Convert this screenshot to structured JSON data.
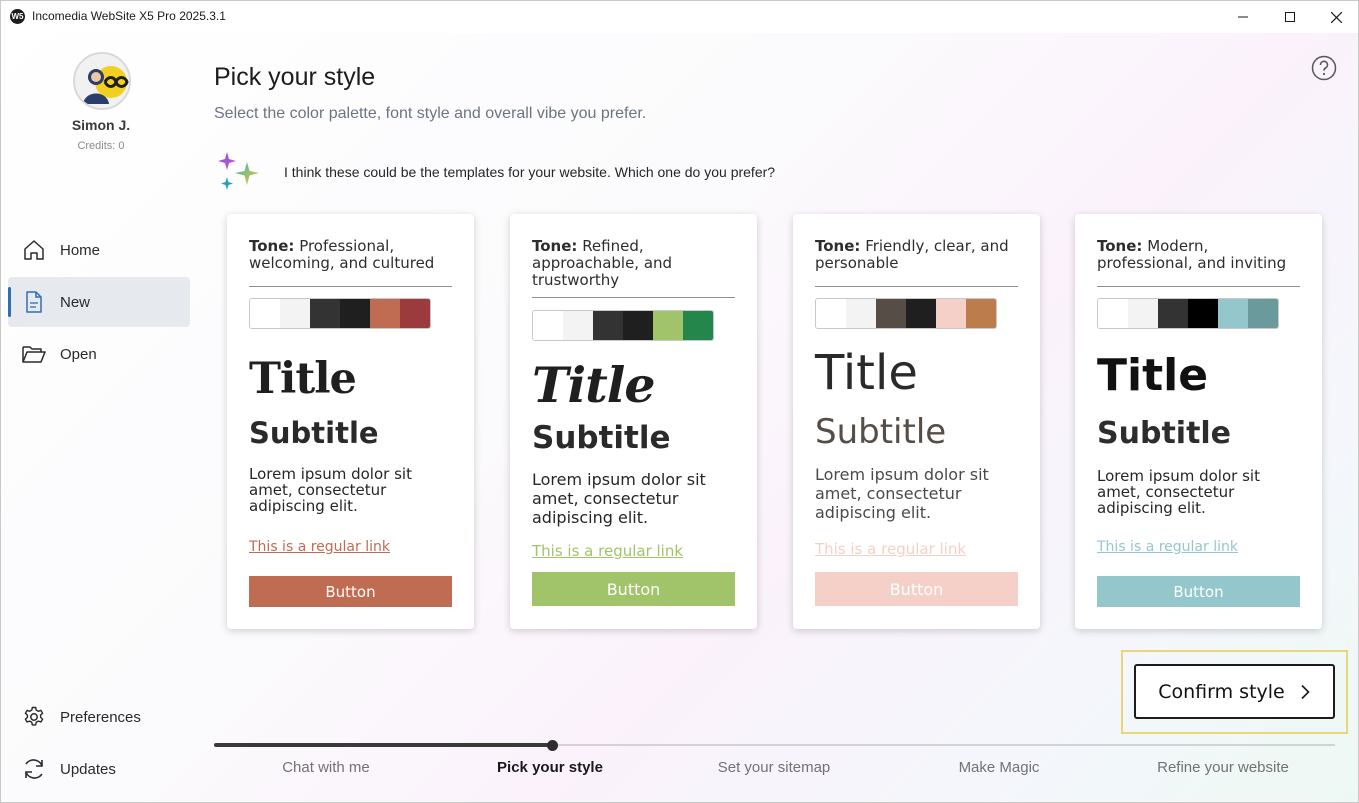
{
  "window": {
    "title": "Incomedia WebSite X5 Pro 2025.3.1",
    "app_icon_text": "W5"
  },
  "user": {
    "name": "Simon J.",
    "credits": "Credits: 0"
  },
  "sidebar": {
    "items": [
      {
        "label": "Home",
        "icon": "home-icon"
      },
      {
        "label": "New",
        "icon": "new-file-icon",
        "active": true
      },
      {
        "label": "Open",
        "icon": "folder-open-icon"
      }
    ],
    "bottom_items": [
      {
        "label": "Preferences",
        "icon": "gear-icon"
      },
      {
        "label": "Updates",
        "icon": "refresh-icon"
      }
    ]
  },
  "main": {
    "title": "Pick your style",
    "subtitle": "Select the color palette, font style and overall vibe you prefer.",
    "ai_message": "I think these could be the templates for your website. Which one do you prefer?"
  },
  "templates": [
    {
      "tone_label": "Tone:",
      "tone": "Professional, welcoming, and cultured",
      "palette": [
        "#ffffff",
        "#f3f3f3",
        "#333333",
        "#1f1f1f",
        "#c06c52",
        "#9c3b3d"
      ],
      "sample_title": "Title",
      "sample_subtitle": "Subtitle",
      "sample_body": "Lorem ipsum dolor sit amet, consectetur adipiscing elit.",
      "sample_link": "This is a regular link",
      "sample_button": "Button",
      "link_color": "#c06c52",
      "button_color": "#c06c52"
    },
    {
      "tone_label": "Tone:",
      "tone": "Refined, approachable, and trustworthy",
      "palette": [
        "#ffffff",
        "#f3f3f3",
        "#333333",
        "#1f1f1f",
        "#a1c46a",
        "#24864a"
      ],
      "sample_title": "Title",
      "sample_subtitle": "Subtitle",
      "sample_body": "Lorem ipsum dolor sit amet, consectetur adipiscing elit.",
      "sample_link": "This is a regular link",
      "sample_button": "Button",
      "link_color": "#a1c46a",
      "button_color": "#a1c46a"
    },
    {
      "tone_label": "Tone:",
      "tone": "Friendly, clear, and personable",
      "palette": [
        "#ffffff",
        "#f3f3f3",
        "#574d47",
        "#1f1f1f",
        "#f5d0c8",
        "#bd7c4c"
      ],
      "sample_title": "Title",
      "sample_subtitle": "Subtitle",
      "sample_body": "Lorem ipsum dolor sit amet, consectetur adipiscing elit.",
      "sample_link": "This is a regular link",
      "sample_button": "Button",
      "link_color": "#f5d0c8",
      "button_color": "#f5d0c8"
    },
    {
      "tone_label": "Tone:",
      "tone": "Modern, professional, and inviting",
      "palette": [
        "#ffffff",
        "#f3f3f3",
        "#333333",
        "#000000",
        "#94c7cc",
        "#6b9a9d"
      ],
      "sample_title": "Title",
      "sample_subtitle": "Subtitle",
      "sample_body": "Lorem ipsum dolor sit amet, consectetur adipiscing elit.",
      "sample_link": "This is a regular link",
      "sample_button": "Button",
      "link_color": "#94c7cc",
      "button_color": "#94c7cc"
    }
  ],
  "confirm": {
    "label": "Confirm style",
    "icon": "chevron-right-icon"
  },
  "steps": {
    "items": [
      "Chat with me",
      "Pick your style",
      "Set your sitemap",
      "Make Magic",
      "Refine your website"
    ],
    "current_index": 1
  }
}
